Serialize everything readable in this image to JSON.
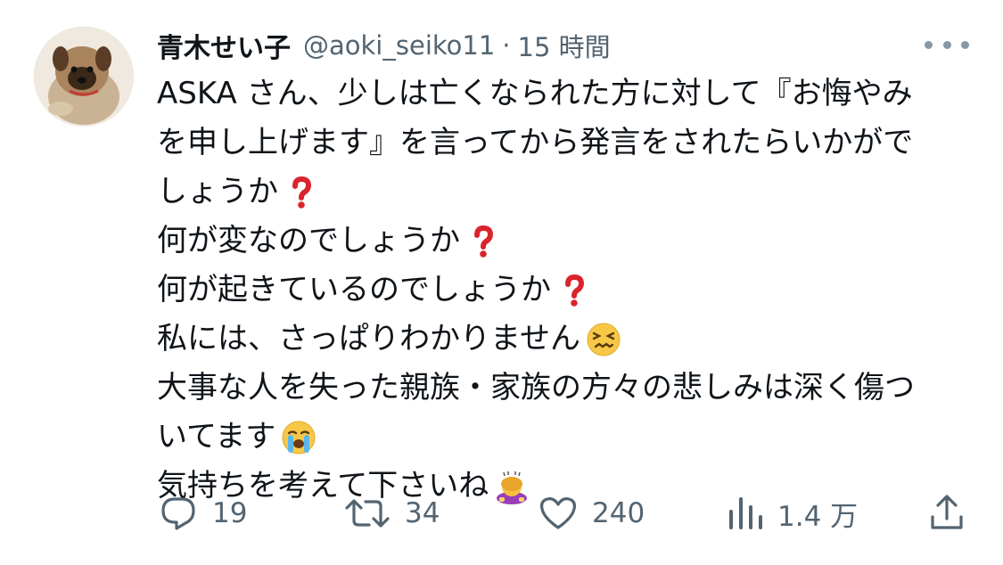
{
  "tweet": {
    "author": {
      "display_name": "青木せい子",
      "handle": "@aoki_seiko11",
      "separator": "·",
      "time": "15 時間"
    },
    "lines": [
      "ASKA さん、少しは亡くなられた方に対して『お悔やみ",
      "を申し上げます』を言ってから発言をされたらいかがで",
      "しょうか",
      "何が変なのでしょうか",
      "何が起きているのでしょうか",
      "私には、さっぱりわかりません",
      "大事な人を失った親族・家族の方々の悲しみは深く傷つ",
      "いてます",
      "気持ちを考えて下さいね"
    ],
    "emojis": {
      "line3": "red-question-mark",
      "line4": "red-question-mark",
      "line5": "red-question-mark",
      "line6": "confounded-face",
      "line8": "loudly-crying-face",
      "line9": "person-bowing"
    },
    "actions": {
      "reply": {
        "icon": "reply-bubble-icon",
        "count": "19"
      },
      "retweet": {
        "icon": "retweet-icon",
        "count": "34"
      },
      "like": {
        "icon": "heart-icon",
        "count": "240"
      },
      "views": {
        "icon": "views-bars-icon",
        "count": "1.4 万"
      },
      "share": {
        "icon": "share-upload-icon"
      }
    }
  },
  "colors": {
    "text": "#0f1419",
    "secondary": "#536471",
    "question_red": "#d9242c"
  }
}
